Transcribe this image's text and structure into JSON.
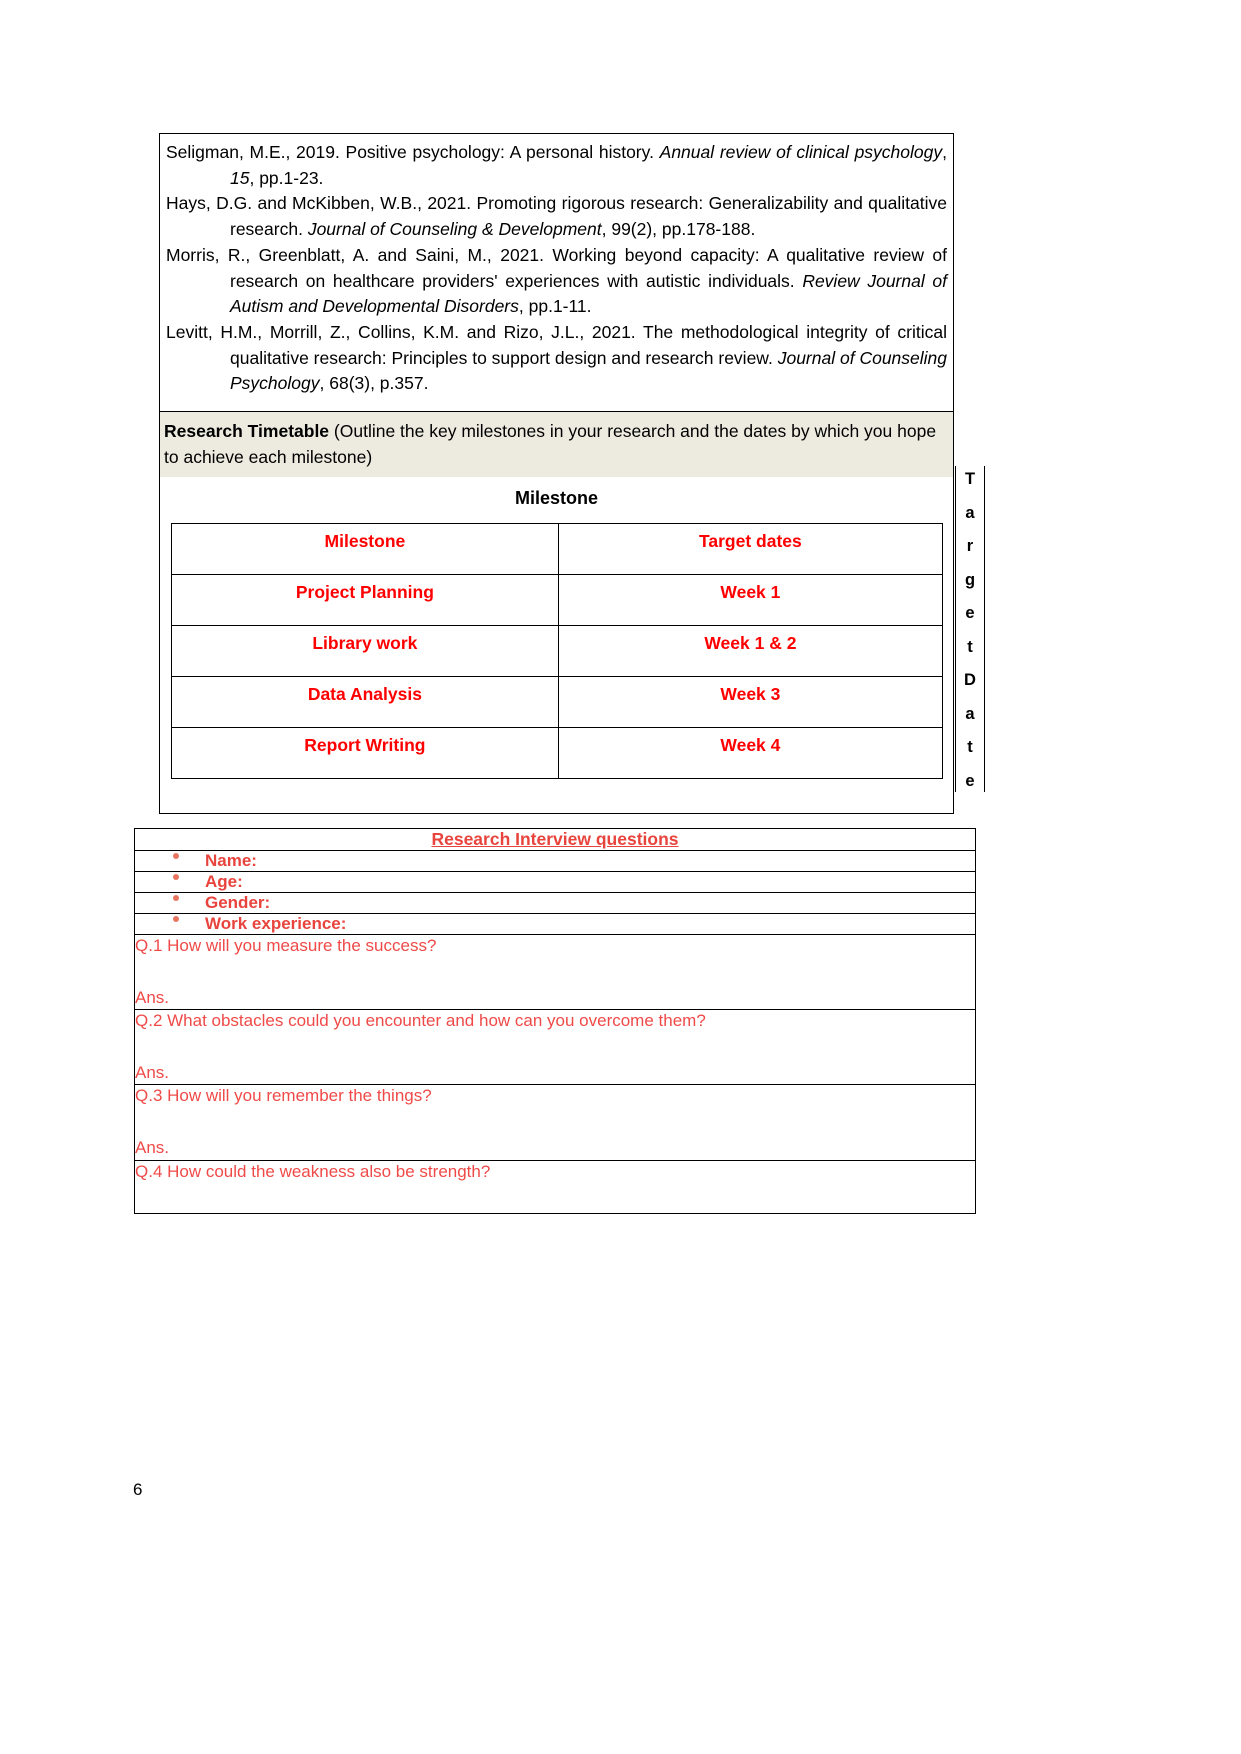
{
  "references": [
    {
      "parts": [
        {
          "t": "Seligman, M.E., 2019. Positive psychology: A personal history. ",
          "i": false
        },
        {
          "t": "Annual review of clinical psychology",
          "i": true
        },
        {
          "t": ", ",
          "i": false
        },
        {
          "t": "15",
          "i": true
        },
        {
          "t": ", pp.1-23.",
          "i": false
        }
      ]
    },
    {
      "parts": [
        {
          "t": "Hays, D.G. and McKibben, W.B., 2021. Promoting rigorous research: Generalizability and qualitative research. ",
          "i": false
        },
        {
          "t": "Journal of Counseling & Development",
          "i": true
        },
        {
          "t": ", 99(2), pp.178-188.",
          "i": false
        }
      ]
    },
    {
      "parts": [
        {
          "t": "Morris, R., Greenblatt, A. and Saini, M., 2021. Working beyond capacity: A qualitative review of research on healthcare providers' experiences with autistic individuals. ",
          "i": false
        },
        {
          "t": "Review Journal of Autism and Developmental Disorders",
          "i": true
        },
        {
          "t": ", pp.1-11.",
          "i": false
        }
      ]
    },
    {
      "parts": [
        {
          "t": "Levitt, H.M., Morrill, Z., Collins, K.M. and Rizo, J.L., 2021. The methodological integrity of critical qualitative research: Principles to support design and research review. ",
          "i": false
        },
        {
          "t": "Journal of Counseling Psychology",
          "i": true
        },
        {
          "t": ", 68(3), p.357.",
          "i": false
        }
      ]
    }
  ],
  "timetable": {
    "banner_bold": "Research Timetable",
    "banner_rest": " (Outline the key milestones in your research and the dates by which  you hope to achieve each milestone)",
    "caption": "Milestone",
    "vertical_label": "Target Date",
    "vertical_letters": [
      "T",
      "a",
      "r",
      "g",
      "e",
      "t",
      "D",
      "a",
      "t",
      "e"
    ],
    "headers": [
      "Milestone",
      "Target dates"
    ],
    "rows": [
      {
        "milestone": "Project Planning",
        "target": "Week 1"
      },
      {
        "milestone": "Library work",
        "target": "Week 1 & 2"
      },
      {
        "milestone": "Data Analysis",
        "target": "Week 3"
      },
      {
        "milestone": "Report Writing",
        "target": "Week 4"
      }
    ]
  },
  "interview": {
    "title": "Research Interview questions",
    "fields": [
      {
        "label": "Name:"
      },
      {
        "label": "Age:"
      },
      {
        "label": "Gender:"
      },
      {
        "label": "Work experience:"
      }
    ],
    "questions": [
      {
        "q": "Q.1 How will you measure the success?",
        "a": "Ans."
      },
      {
        "q": "Q.2 What obstacles could you encounter and how can you overcome them?",
        "a": "Ans."
      },
      {
        "q": "Q.3 How will you remember the things?",
        "a": "Ans."
      },
      {
        "q": "Q.4 How could the weakness also be strength?",
        "a": ""
      }
    ]
  },
  "footer": {
    "page_number": "6"
  },
  "colors": {
    "table_red": "#ff0000",
    "interview_red": "#e8443d",
    "question_red": "#ef4a48",
    "banner_bg": "#edebe0"
  }
}
